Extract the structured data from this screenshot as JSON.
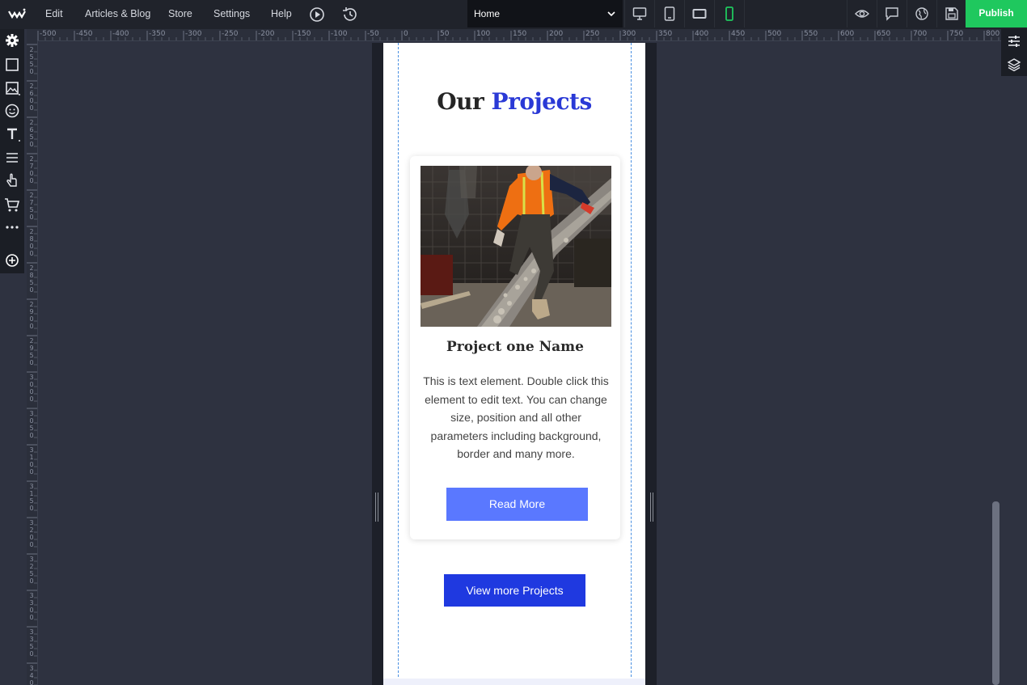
{
  "topbar": {
    "menu": [
      "Edit",
      "Articles & Blog",
      "Store",
      "Settings",
      "Help"
    ],
    "page_select": "Home",
    "publish_label": "Publish"
  },
  "ruler": {
    "h_labels": [
      "-500",
      "-450",
      "-400",
      "-350",
      "-300",
      "-250",
      "-200",
      "-150",
      "-100",
      "-50",
      "0",
      "50",
      "100",
      "150",
      "200",
      "250",
      "300",
      "350",
      "400",
      "450",
      "500",
      "550",
      "600",
      "650",
      "700",
      "750",
      "800"
    ],
    "v_labels": [
      "2550",
      "2600",
      "2650",
      "2700",
      "2750",
      "2800",
      "2850",
      "2900",
      "2950",
      "3000",
      "3050",
      "3100",
      "3150",
      "3200",
      "3250",
      "3300",
      "3350",
      "3400"
    ]
  },
  "page": {
    "title_part1": "Our",
    "title_part2": "Projects",
    "card": {
      "title": "Project one Name",
      "text": "This is text element. Double click this element to edit text. You can change size, position and all other parameters including background, border and many more.",
      "button_label": "Read More"
    },
    "view_more_label": "View more Projects"
  },
  "colors": {
    "accent_blue": "#2a39d6",
    "read_more_bg": "#5a78ff",
    "view_more_bg": "#1f39e0",
    "publish_bg": "#1fc85e",
    "active_device": "#1fc85e"
  }
}
